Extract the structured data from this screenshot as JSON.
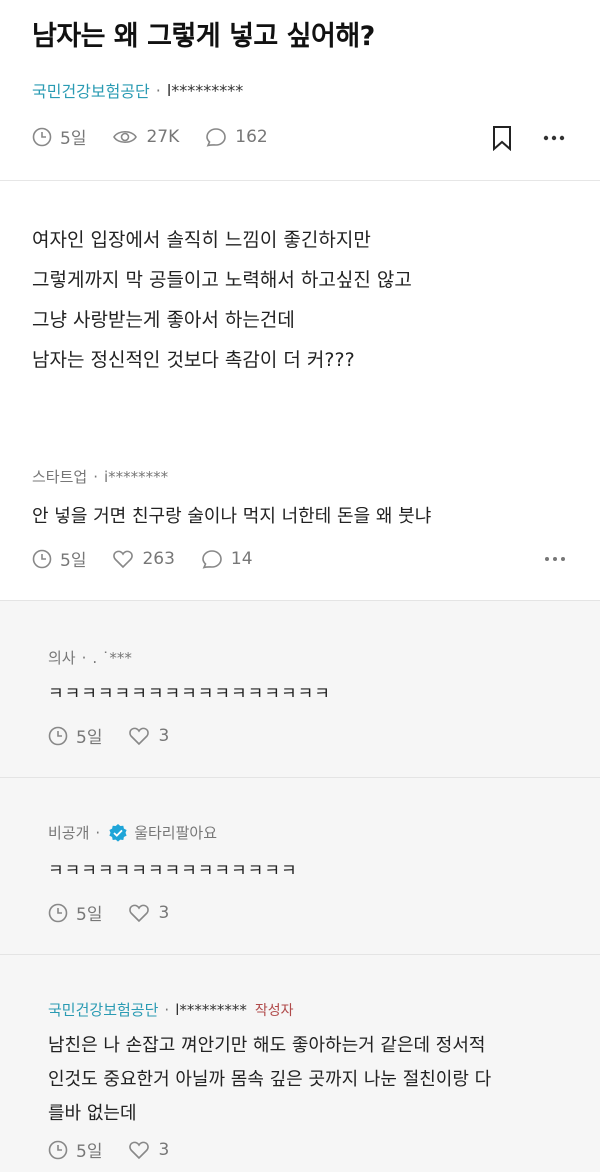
{
  "post": {
    "title": "남자는 왜 그렇게 넣고 싶어해?",
    "company": "국민건강보험공단",
    "separator": "·",
    "author": "l*********",
    "time": "5일",
    "views": "27K",
    "comments": "162",
    "body": [
      "여자인 입장에서 솔직히 느낌이 좋긴하지만",
      "그렇게까지 막 공들이고 노력해서 하고싶진 않고",
      "그냥 사랑받는게 좋아서 하는건데",
      "남자는 정신적인 것보다 촉감이 더 커???"
    ]
  },
  "comment": {
    "company": "스타트업",
    "separator": "·",
    "author": "i********",
    "text": "안 넣을 거면 친구랑 술이나 먹지 너한테 돈을 왜 붓냐",
    "time": "5일",
    "likes": "263",
    "replies": "14"
  },
  "replies": [
    {
      "company": "의사",
      "separator": "·",
      "author": ". ˙***",
      "text": "ㅋㅋㅋㅋㅋㅋㅋㅋㅋㅋㅋㅋㅋㅋㅋㅋㅋ",
      "time": "5일",
      "likes": "3"
    },
    {
      "company": "비공개",
      "separator": "·",
      "author": "울타리팔아요",
      "text": "ㅋㅋㅋㅋㅋㅋㅋㅋㅋㅋㅋㅋㅋㅋㅋ",
      "time": "5일",
      "likes": "3"
    },
    {
      "company": "국민건강보험공단",
      "separator": "·",
      "author": "l*********",
      "author_tag": "작성자",
      "text_lines": [
        "남친은 나 손잡고 껴안기만 해도 좋아하는거 같은데 정서적",
        "인것도 중요한거 아닐까 몸속 깊은 곳까지 나눈 절친이랑 다",
        "를바 없는데"
      ],
      "time": "5일",
      "likes": "3"
    }
  ],
  "colors": {
    "accent": "#2a9bb3",
    "author_tag": "#b04a4a",
    "verified": "#1fa5d8"
  }
}
